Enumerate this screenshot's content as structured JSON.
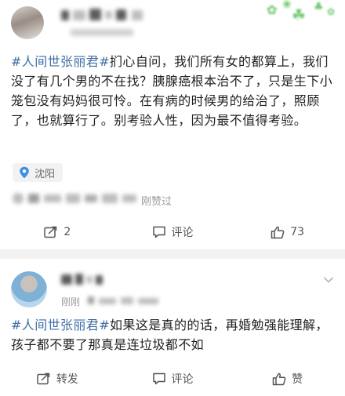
{
  "post1": {
    "content": {
      "topic": "#人间世张丽君#",
      "text": "扪心自问，我们所有女的都算上，我们没了有几个男的不在找？胰腺癌根本治不了，只是生下小笼包没有妈妈很可怜。在有病的时候男的给治了，照顾了，也就算行了。别考验人性，因为最不值得考验。"
    },
    "location": "沈阳",
    "liked_text": "刚赞过",
    "actions": {
      "share_count": "2",
      "comment_label": "评论",
      "like_count": "73"
    }
  },
  "post2": {
    "time_text": "刚刚",
    "content": {
      "topic": "#人间世张丽君#",
      "text": "如果这是真的的话，再婚勉强能理解，孩子都不要了那真是连垃圾都不如"
    },
    "actions": {
      "repost_label": "转发",
      "comment_label": "评论",
      "like_label": "赞"
    }
  },
  "colors": {
    "topic": "#3f6ea6",
    "separator": "#f2f2f2",
    "meta": "#9b9b9b"
  },
  "icons": [
    "location-pin-icon",
    "share-icon",
    "comment-icon",
    "like-icon",
    "chevron-down-icon"
  ]
}
